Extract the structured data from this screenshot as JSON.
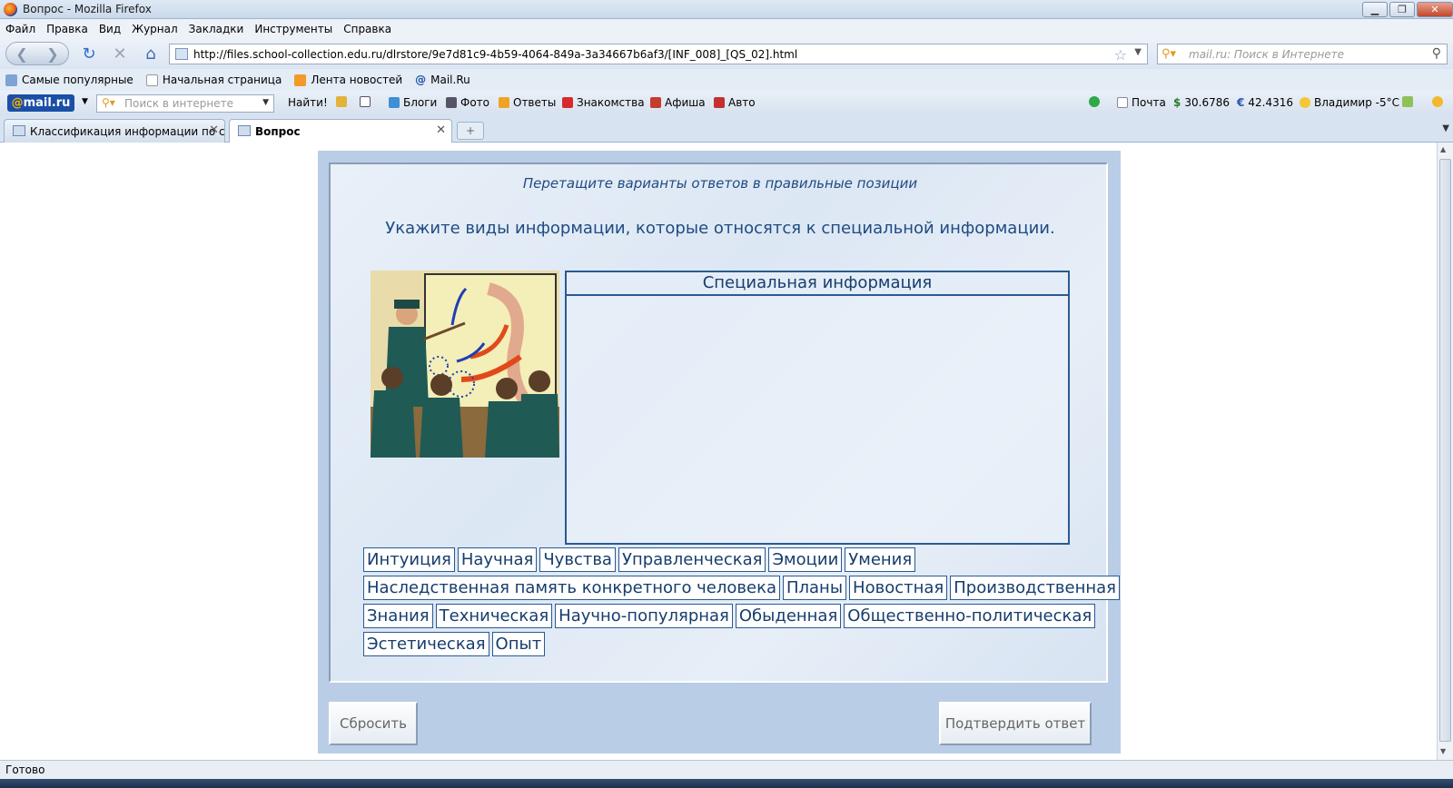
{
  "window": {
    "title": "Вопрос - Mozilla Firefox"
  },
  "menu": [
    "Файл",
    "Правка",
    "Вид",
    "Журнал",
    "Закладки",
    "Инструменты",
    "Справка"
  ],
  "nav": {
    "url": "http://files.school-collection.edu.ru/dlrstore/9e7d81c9-4b59-4064-849a-3a34667b6af3/[INF_008]_[QS_02].html",
    "search_placeholder": "mail.ru: Поиск в Интернете"
  },
  "bookmarks": [
    "Самые популярные",
    "Начальная страница",
    "Лента новостей",
    "Mail.Ru"
  ],
  "mailru": {
    "logo_at": "@",
    "logo_text": "mail.ru",
    "search_placeholder": "Поиск в интернете",
    "find": "Найти!",
    "items": [
      "Блоги",
      "Фото",
      "Ответы",
      "Знакомства",
      "Афиша",
      "Авто"
    ],
    "mail": "Почта",
    "usd": "30.6786",
    "eur": "42.4316",
    "weather": "Владимир -5°C"
  },
  "tabs": [
    {
      "label": "Классификация информации по с...",
      "active": false
    },
    {
      "label": "Вопрос",
      "active": true
    }
  ],
  "quiz": {
    "instruction": "Перетащите варианты ответов в правильные позиции",
    "question": "Укажите виды информации, которые относятся к специальной информации.",
    "dropzone_title": "Специальная информация",
    "chips": [
      [
        "Интуиция",
        "Научная",
        "Чувства",
        "Управленческая",
        "Эмоции",
        "Умения"
      ],
      [
        "Наследственная память конкретного человека",
        "Планы",
        "Новостная",
        "Производственная"
      ],
      [
        "Знания",
        "Техническая",
        "Научно-популярная",
        "Обыденная",
        "Общественно-политическая"
      ],
      [
        "Эстетическая",
        "Опыт"
      ]
    ],
    "reset_label": "Сбросить",
    "submit_label": "Подтвердить ответ"
  },
  "status": {
    "text": "Готово"
  },
  "colors": {
    "accent": "#1f4b82",
    "chip_border": "#2a5a92",
    "panel": "#b9cde6"
  }
}
